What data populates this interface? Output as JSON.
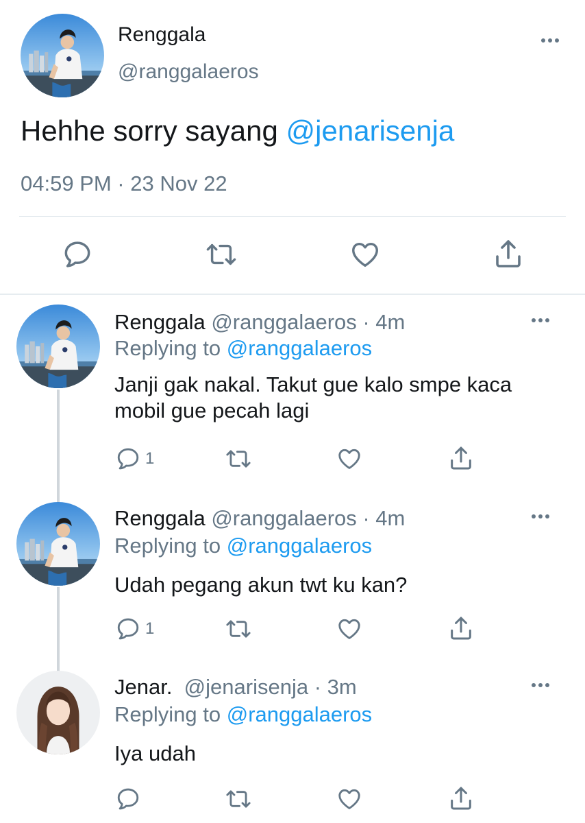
{
  "colors": {
    "accent": "#1d9bf0",
    "secondary_text": "#657786",
    "primary_text": "#14171a",
    "divider": "#e1e8ed"
  },
  "main_tweet": {
    "name": "Renggala",
    "handle": "@ranggalaeros",
    "text_plain": "Hehhe sorry sayang ",
    "text_mention": "@jenarisenja",
    "timestamp": "04:59 PM · 23 Nov 22",
    "actions": [
      "reply-icon",
      "retweet-icon",
      "like-icon",
      "share-icon"
    ]
  },
  "replies": [
    {
      "name": "Renggala",
      "meta": " @ranggalaeros · 4m",
      "replying_label": "Replying to ",
      "replying_handle": "@ranggalaeros",
      "text": "Janji gak nakal. Takut gue kalo smpe kaca mobil gue pecah lagi",
      "reply_count": "1"
    },
    {
      "name": "Renggala",
      "meta": " @ranggalaeros · 4m",
      "replying_label": "Replying to ",
      "replying_handle": "@ranggalaeros",
      "text": "Udah pegang akun twt ku kan?",
      "reply_count": "1"
    },
    {
      "name": "Jenar.",
      "meta": "  @jenarisenja · 3m",
      "replying_label": "Replying to ",
      "replying_handle": "@ranggalaeros",
      "text": "Iya udah",
      "reply_count": ""
    }
  ]
}
